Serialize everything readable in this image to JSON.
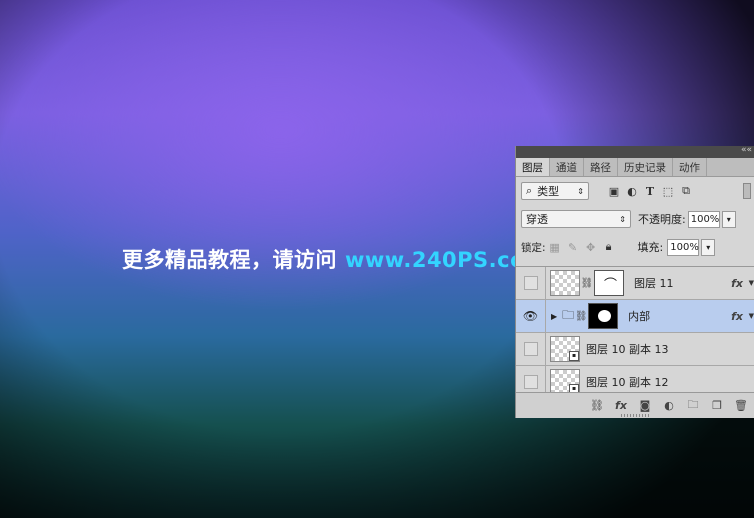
{
  "watermark": {
    "text": "更多精品教程，请访问",
    "url": "www.240PS.com"
  },
  "panel": {
    "collapse_icon": "««",
    "tabs": [
      {
        "label": "图层"
      },
      {
        "label": "通道"
      },
      {
        "label": "路径"
      },
      {
        "label": "历史记录"
      },
      {
        "label": "动作"
      }
    ],
    "filter": {
      "label": "类型"
    },
    "blend_mode": "穿透",
    "opacity_label": "不透明度:",
    "opacity_value": "100%",
    "lock_label": "锁定:",
    "fill_label": "填充:",
    "fill_value": "100%",
    "layers": [
      {
        "name": "图层  11",
        "fx": "fx",
        "visible": false,
        "selected": false
      },
      {
        "name": "内部",
        "fx": "fx",
        "visible": true,
        "selected": true
      },
      {
        "name": "图层  10  副本  13",
        "visible": false,
        "selected": false
      },
      {
        "name": "图层  10  副本  12",
        "visible": false,
        "selected": false
      }
    ],
    "bottom_icons": [
      "link-icon",
      "fx-icon",
      "mask-icon",
      "adjustment-icon",
      "folder-icon",
      "new-layer-icon",
      "trash-icon"
    ]
  }
}
